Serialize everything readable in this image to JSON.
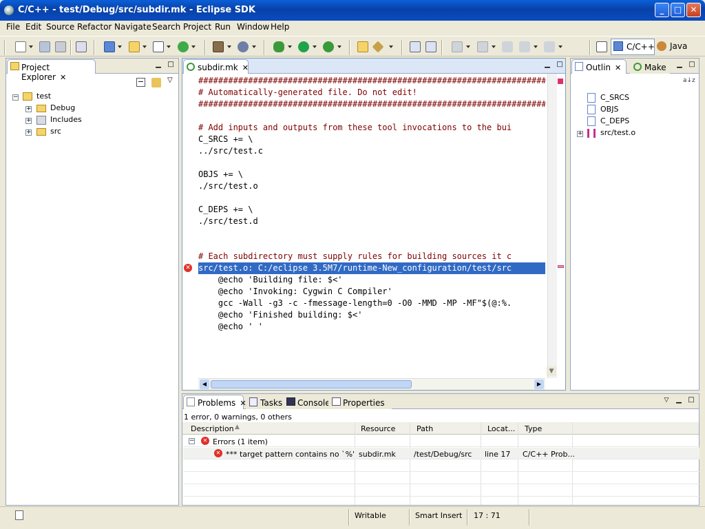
{
  "window": {
    "title": "C/C++ - test/Debug/src/subdir.mk - Eclipse SDK",
    "min_glyph": "_",
    "max_glyph": "□",
    "close_glyph": "✕"
  },
  "menu": [
    "File",
    "Edit",
    "Source",
    "Refactor",
    "Navigate",
    "Search",
    "Project",
    "Run",
    "Window",
    "Help"
  ],
  "perspectives": {
    "cpp": "C/C++",
    "java": "Java"
  },
  "project_explorer": {
    "tab": "Project Explorer",
    "tree": {
      "root": "test",
      "children": [
        "Debug",
        "Includes",
        "src"
      ]
    }
  },
  "editor": {
    "tab": "subdir.mk",
    "lines": [
      {
        "t": "################################################################################",
        "c": "cmt"
      },
      {
        "t": "# Automatically-generated file. Do not edit!",
        "c": "cmt"
      },
      {
        "t": "################################################################################",
        "c": "cmt"
      },
      {
        "t": "",
        "c": ""
      },
      {
        "t": "# Add inputs and outputs from these tool invocations to the bui",
        "c": "cmt"
      },
      {
        "t": "C_SRCS += \\",
        "c": ""
      },
      {
        "t": "../src/test.c",
        "c": ""
      },
      {
        "t": "",
        "c": ""
      },
      {
        "t": "OBJS += \\",
        "c": ""
      },
      {
        "t": "./src/test.o",
        "c": ""
      },
      {
        "t": "",
        "c": ""
      },
      {
        "t": "C_DEPS += \\",
        "c": ""
      },
      {
        "t": "./src/test.d",
        "c": ""
      },
      {
        "t": "",
        "c": ""
      },
      {
        "t": "",
        "c": ""
      },
      {
        "t": "# Each subdirectory must supply rules for building sources it c",
        "c": "cmt"
      },
      {
        "t": "src/test.o: C:/eclipse 3.5M7/runtime-New_configuration/test/src",
        "c": "sel"
      },
      {
        "t": "    @echo 'Building file: $<'",
        "c": ""
      },
      {
        "t": "    @echo 'Invoking: Cygwin C Compiler'",
        "c": ""
      },
      {
        "t": "    gcc -Wall -g3 -c -fmessage-length=0 -O0 -MMD -MP -MF\"$(@:%.",
        "c": ""
      },
      {
        "t": "    @echo 'Finished building: $<'",
        "c": ""
      },
      {
        "t": "    @echo ' '",
        "c": ""
      }
    ]
  },
  "outline": {
    "tab": "Outlin",
    "make_tab": "Make",
    "sort_glyph": "a↓z",
    "items": [
      "C_SRCS",
      "OBJS",
      "C_DEPS",
      "src/test.o"
    ]
  },
  "bottom": {
    "tabs": [
      "Problems",
      "Tasks",
      "Console",
      "Properties"
    ],
    "summary": "1 error, 0 warnings, 0 others",
    "columns": [
      "Description",
      "Resource",
      "Path",
      "Locat...",
      "Type"
    ],
    "group": "Errors (1 item)",
    "rows": [
      {
        "description": "*** target pattern contains no `%'.  St",
        "resource": "subdir.mk",
        "path": "/test/Debug/src",
        "location": "line 17",
        "type": "C/C++ Prob..."
      }
    ]
  },
  "status": {
    "writable": "Writable",
    "insert_mode": "Smart Insert",
    "position": "17 : 71"
  },
  "colors": {
    "accent": "#316ac5",
    "comment": "#7f0000",
    "error": "#e0302a"
  }
}
